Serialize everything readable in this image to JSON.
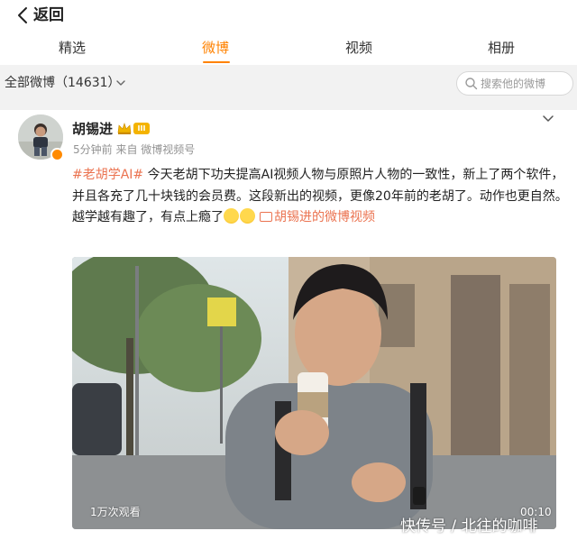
{
  "header": {
    "back_label": "返回"
  },
  "tabs": [
    {
      "label": "精选",
      "active": false
    },
    {
      "label": "微博",
      "active": true
    },
    {
      "label": "视频",
      "active": false
    },
    {
      "label": "相册",
      "active": false
    }
  ],
  "filter": {
    "label": "全部微博（14631）",
    "search_placeholder": "搜索他的微博"
  },
  "post": {
    "username": "胡锡进",
    "level": "III",
    "meta": "5分钟前  来自 微博视频号",
    "hashtag": "#老胡学AI#",
    "body": " 今天老胡下功夫提高AI视频人物与原照片人物的一致性，新上了两个软件，并且各充了几十块钱的会员费。这段新出的视频，更像20年前的老胡了。动作也更自然。",
    "body2": "越学越有趣了，有点上瘾了",
    "video_link": "胡锡进的微博视频",
    "video_views": "1万次观看",
    "video_duration": "00:10"
  },
  "watermark": "快传号 / 北往的咖啡",
  "colors": {
    "accent": "#ff8200",
    "link": "#eb7350",
    "filter_bg": "#f2f2f2"
  }
}
